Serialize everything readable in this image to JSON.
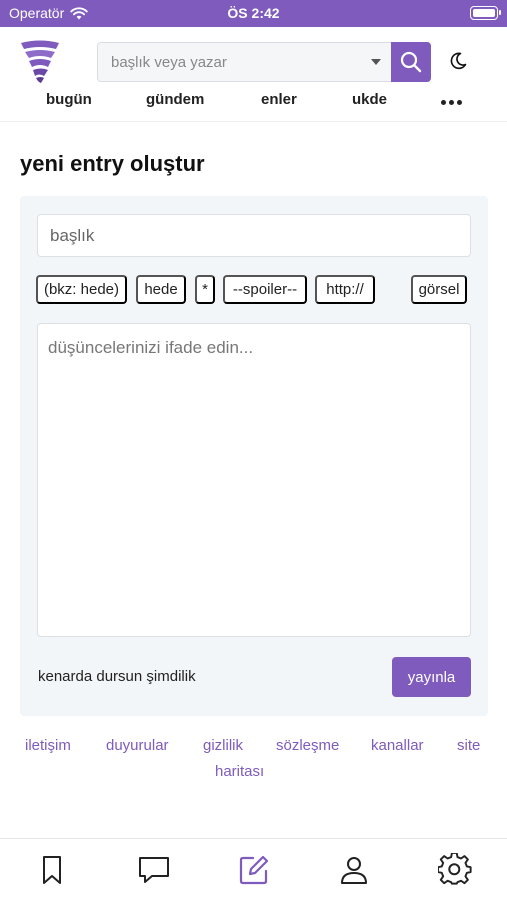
{
  "status_bar": {
    "carrier": "Operatör",
    "time": "ÖS 2:42"
  },
  "header": {
    "search": {
      "placeholder": "başlık veya yazar"
    },
    "nav": [
      {
        "label": "bugün"
      },
      {
        "label": "gündem"
      },
      {
        "label": "enler"
      },
      {
        "label": "ukde"
      }
    ]
  },
  "page": {
    "title": "yeni entry oluştur"
  },
  "form": {
    "title_placeholder": "başlık",
    "tools": [
      {
        "label": "(bkz: hede)"
      },
      {
        "label": "hede"
      },
      {
        "label": "*"
      },
      {
        "label": "--spoiler--"
      },
      {
        "label": "http://"
      },
      {
        "label": "görsel"
      }
    ],
    "body_placeholder": "düşüncelerinizi ifade edin...",
    "draft_label": "kenarda dursun şimdilik",
    "publish_label": "yayınla"
  },
  "footer": {
    "links": [
      {
        "label": "iletişim"
      },
      {
        "label": "duyurular"
      },
      {
        "label": "gizlilik"
      },
      {
        "label": "sözleşme"
      },
      {
        "label": "kanallar"
      },
      {
        "label": "site"
      },
      {
        "label": "haritası"
      }
    ]
  },
  "tabbar": {
    "items": [
      {
        "icon": "bookmark-icon"
      },
      {
        "icon": "messages-icon"
      },
      {
        "icon": "compose-icon"
      },
      {
        "icon": "profile-icon"
      },
      {
        "icon": "settings-icon"
      }
    ]
  },
  "colors": {
    "accent": "#7e5bbd",
    "card_background": "#f3f6f9"
  }
}
